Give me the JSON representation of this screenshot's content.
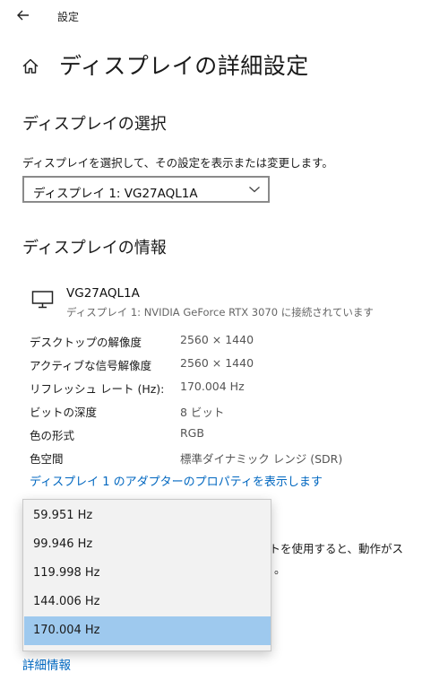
{
  "window": {
    "title": "設定"
  },
  "page": {
    "title": "ディスプレイの詳細設定"
  },
  "select_section": {
    "heading": "ディスプレイの選択",
    "description": "ディスプレイを選択して、その設定を表示または変更します。",
    "selected_display": "ディスプレイ 1: VG27AQL1A"
  },
  "info_section": {
    "heading": "ディスプレイの情報",
    "monitor_name": "VG27AQL1A",
    "monitor_sub": "ディスプレイ 1: NVIDIA GeForce RTX 3070 に接続されています",
    "rows": [
      {
        "label": "デスクトップの解像度",
        "value": "2560 × 1440"
      },
      {
        "label": "アクティブな信号解像度",
        "value": "2560 × 1440"
      },
      {
        "label": "リフレッシュ レート (Hz):",
        "value": "170.004 Hz"
      },
      {
        "label": "ビットの深度",
        "value": "8 ビット"
      },
      {
        "label": "色の形式",
        "value": "RGB"
      },
      {
        "label": "色空間",
        "value": "標準ダイナミック レンジ (SDR)"
      }
    ],
    "adapter_link": "ディスプレイ 1 のアダプターのプロパティを表示します"
  },
  "refresh_section": {
    "partial_line1": "ートを使用すると、動作がス",
    "partial_line2": "。"
  },
  "refresh_dropdown": {
    "options": [
      "59.951 Hz",
      "99.946 Hz",
      "119.998 Hz",
      "144.006 Hz",
      "170.004 Hz"
    ],
    "selected_index": 4
  },
  "footer": {
    "more_info_link": "詳細情報"
  },
  "colors": {
    "accent": "#0067c0",
    "selected_bg": "#9ec9ee"
  },
  "icons": [
    "back-arrow-icon",
    "home-icon",
    "chevron-down-icon",
    "monitor-icon"
  ]
}
